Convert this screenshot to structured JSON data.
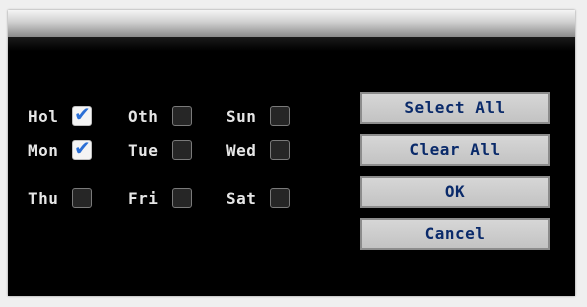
{
  "schedule": {
    "days": [
      {
        "label": "Hol",
        "checked": true
      },
      {
        "label": "Oth",
        "checked": false
      },
      {
        "label": "Sun",
        "checked": false
      },
      {
        "label": "Mon",
        "checked": true
      },
      {
        "label": "Tue",
        "checked": false
      },
      {
        "label": "Wed",
        "checked": false
      },
      {
        "label": "Thu",
        "checked": false
      },
      {
        "label": "Fri",
        "checked": false
      },
      {
        "label": "Sat",
        "checked": false
      }
    ]
  },
  "buttons": {
    "select_all": "Select All",
    "clear_all": "Clear All",
    "ok": "OK",
    "cancel": "Cancel"
  },
  "icons": {
    "checked": "checkmark-icon"
  },
  "colors": {
    "background": "#000000",
    "label_text": "#e6e6e6",
    "button_text": "#0a2a6a",
    "check": "#2a6fd6",
    "button_face": "#cfcfcf"
  }
}
